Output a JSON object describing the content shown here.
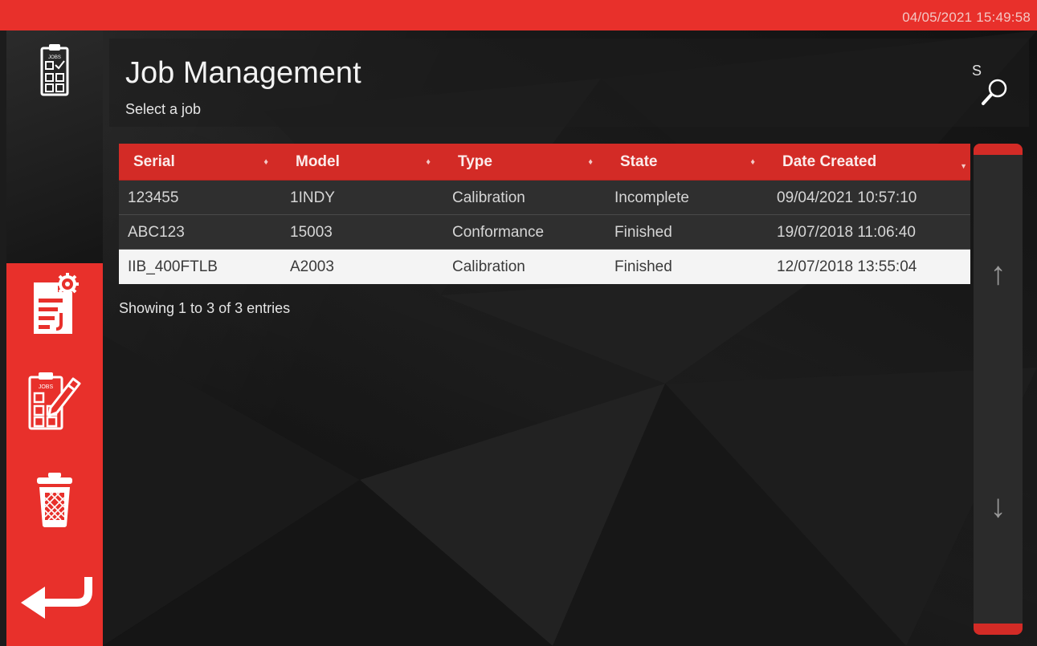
{
  "status_bar": {
    "datetime": "04/05/2021 15:49:58"
  },
  "nav": {
    "items": [
      {
        "name": "jobs",
        "icon": "jobs-clipboard-icon"
      },
      {
        "name": "job-settings",
        "icon": "document-gear-icon"
      },
      {
        "name": "edit-job",
        "icon": "jobs-edit-icon"
      },
      {
        "name": "delete-job",
        "icon": "trash-icon"
      },
      {
        "name": "back",
        "icon": "back-arrow-icon"
      }
    ],
    "jobs_icon_label": "JOBS"
  },
  "header": {
    "title": "Job Management",
    "subtitle": "Select a job",
    "search_letter": "S"
  },
  "table": {
    "columns": [
      "Serial",
      "Model",
      "Type",
      "State",
      "Date Created"
    ],
    "rows": [
      {
        "serial": "123455",
        "model": "1INDY",
        "type": "Calibration",
        "state": "Incomplete",
        "date_created": "09/04/2021 10:57:10"
      },
      {
        "serial": "ABC123",
        "model": "15003",
        "type": "Conformance",
        "state": "Finished",
        "date_created": "19/07/2018 11:06:40"
      },
      {
        "serial": "IIB_400FTLB",
        "model": "A2003",
        "type": "Calibration",
        "state": "Finished",
        "date_created": "12/07/2018 13:55:04"
      }
    ],
    "selected_row": 2,
    "info": "Showing 1 to 3 of 3 entries",
    "sort_glyph": "♦",
    "sort_active_glyph": "▼"
  },
  "scroller": {
    "up_glyph": "↑",
    "down_glyph": "↓"
  },
  "colors": {
    "accent": "#e8302b",
    "header": "#d32b26",
    "background": "#1c1c1c"
  }
}
